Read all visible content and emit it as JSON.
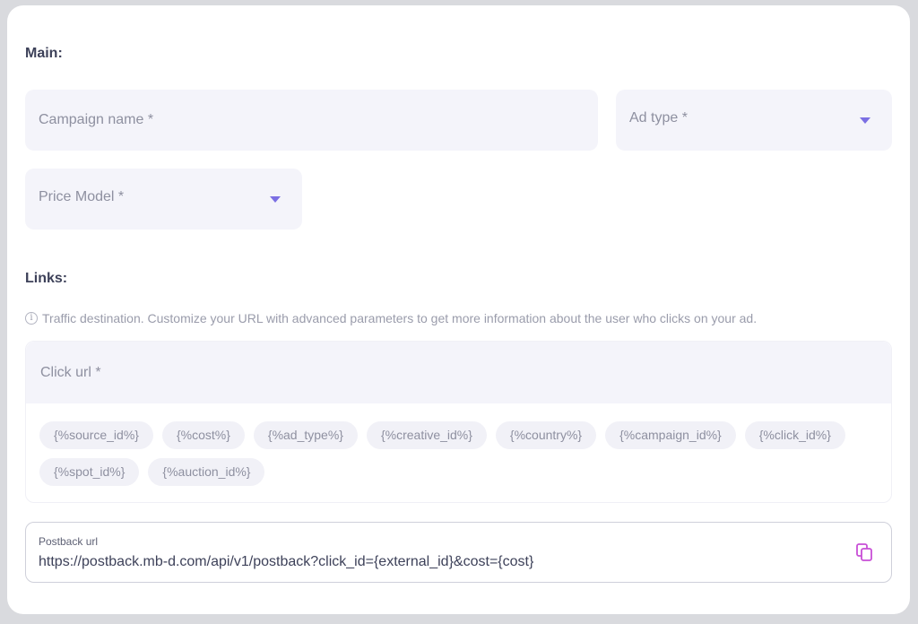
{
  "main": {
    "title": "Main:",
    "campaign_name_placeholder": "Campaign name *",
    "ad_type_placeholder": "Ad type *",
    "price_model_placeholder": "Price Model *"
  },
  "links": {
    "title": "Links:",
    "hint": "Traffic destination. Customize your URL with advanced parameters to get more information about the user who clicks on your ad.",
    "click_url_placeholder": "Click url *",
    "macros": [
      "{%source_id%}",
      "{%cost%}",
      "{%ad_type%}",
      "{%creative_id%}",
      "{%country%}",
      "{%campaign_id%}",
      "{%click_id%}",
      "{%spot_id%}",
      "{%auction_id%}"
    ]
  },
  "postback": {
    "label": "Postback url",
    "value": "https://postback.mb-d.com/api/v1/postback?click_id={external_id}&cost={cost}"
  },
  "icons": {
    "dropdown": "chevron-down-icon",
    "info": "info-icon",
    "copy": "copy-icon"
  },
  "colors": {
    "accent": "#7b6fe3",
    "copy_icon": "#c84fd6",
    "field_bg": "#f4f4fa"
  }
}
